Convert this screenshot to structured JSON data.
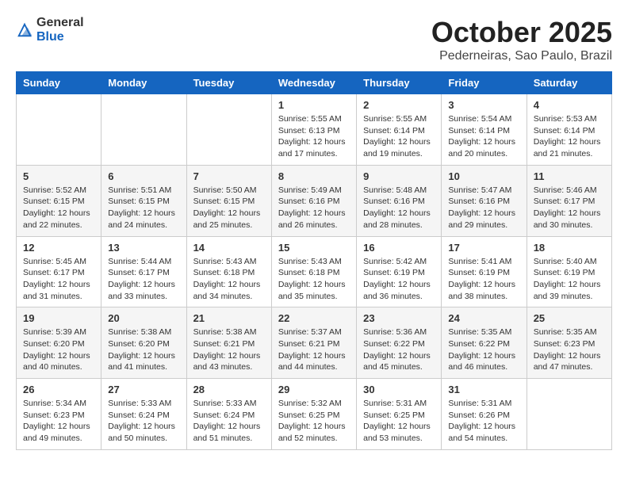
{
  "header": {
    "logo_general": "General",
    "logo_blue": "Blue",
    "month": "October 2025",
    "location": "Pederneiras, Sao Paulo, Brazil"
  },
  "days_of_week": [
    "Sunday",
    "Monday",
    "Tuesday",
    "Wednesday",
    "Thursday",
    "Friday",
    "Saturday"
  ],
  "weeks": [
    [
      {
        "day": "",
        "info": ""
      },
      {
        "day": "",
        "info": ""
      },
      {
        "day": "",
        "info": ""
      },
      {
        "day": "1",
        "info": "Sunrise: 5:55 AM\nSunset: 6:13 PM\nDaylight: 12 hours\nand 17 minutes."
      },
      {
        "day": "2",
        "info": "Sunrise: 5:55 AM\nSunset: 6:14 PM\nDaylight: 12 hours\nand 19 minutes."
      },
      {
        "day": "3",
        "info": "Sunrise: 5:54 AM\nSunset: 6:14 PM\nDaylight: 12 hours\nand 20 minutes."
      },
      {
        "day": "4",
        "info": "Sunrise: 5:53 AM\nSunset: 6:14 PM\nDaylight: 12 hours\nand 21 minutes."
      }
    ],
    [
      {
        "day": "5",
        "info": "Sunrise: 5:52 AM\nSunset: 6:15 PM\nDaylight: 12 hours\nand 22 minutes."
      },
      {
        "day": "6",
        "info": "Sunrise: 5:51 AM\nSunset: 6:15 PM\nDaylight: 12 hours\nand 24 minutes."
      },
      {
        "day": "7",
        "info": "Sunrise: 5:50 AM\nSunset: 6:15 PM\nDaylight: 12 hours\nand 25 minutes."
      },
      {
        "day": "8",
        "info": "Sunrise: 5:49 AM\nSunset: 6:16 PM\nDaylight: 12 hours\nand 26 minutes."
      },
      {
        "day": "9",
        "info": "Sunrise: 5:48 AM\nSunset: 6:16 PM\nDaylight: 12 hours\nand 28 minutes."
      },
      {
        "day": "10",
        "info": "Sunrise: 5:47 AM\nSunset: 6:16 PM\nDaylight: 12 hours\nand 29 minutes."
      },
      {
        "day": "11",
        "info": "Sunrise: 5:46 AM\nSunset: 6:17 PM\nDaylight: 12 hours\nand 30 minutes."
      }
    ],
    [
      {
        "day": "12",
        "info": "Sunrise: 5:45 AM\nSunset: 6:17 PM\nDaylight: 12 hours\nand 31 minutes."
      },
      {
        "day": "13",
        "info": "Sunrise: 5:44 AM\nSunset: 6:17 PM\nDaylight: 12 hours\nand 33 minutes."
      },
      {
        "day": "14",
        "info": "Sunrise: 5:43 AM\nSunset: 6:18 PM\nDaylight: 12 hours\nand 34 minutes."
      },
      {
        "day": "15",
        "info": "Sunrise: 5:43 AM\nSunset: 6:18 PM\nDaylight: 12 hours\nand 35 minutes."
      },
      {
        "day": "16",
        "info": "Sunrise: 5:42 AM\nSunset: 6:19 PM\nDaylight: 12 hours\nand 36 minutes."
      },
      {
        "day": "17",
        "info": "Sunrise: 5:41 AM\nSunset: 6:19 PM\nDaylight: 12 hours\nand 38 minutes."
      },
      {
        "day": "18",
        "info": "Sunrise: 5:40 AM\nSunset: 6:19 PM\nDaylight: 12 hours\nand 39 minutes."
      }
    ],
    [
      {
        "day": "19",
        "info": "Sunrise: 5:39 AM\nSunset: 6:20 PM\nDaylight: 12 hours\nand 40 minutes."
      },
      {
        "day": "20",
        "info": "Sunrise: 5:38 AM\nSunset: 6:20 PM\nDaylight: 12 hours\nand 41 minutes."
      },
      {
        "day": "21",
        "info": "Sunrise: 5:38 AM\nSunset: 6:21 PM\nDaylight: 12 hours\nand 43 minutes."
      },
      {
        "day": "22",
        "info": "Sunrise: 5:37 AM\nSunset: 6:21 PM\nDaylight: 12 hours\nand 44 minutes."
      },
      {
        "day": "23",
        "info": "Sunrise: 5:36 AM\nSunset: 6:22 PM\nDaylight: 12 hours\nand 45 minutes."
      },
      {
        "day": "24",
        "info": "Sunrise: 5:35 AM\nSunset: 6:22 PM\nDaylight: 12 hours\nand 46 minutes."
      },
      {
        "day": "25",
        "info": "Sunrise: 5:35 AM\nSunset: 6:23 PM\nDaylight: 12 hours\nand 47 minutes."
      }
    ],
    [
      {
        "day": "26",
        "info": "Sunrise: 5:34 AM\nSunset: 6:23 PM\nDaylight: 12 hours\nand 49 minutes."
      },
      {
        "day": "27",
        "info": "Sunrise: 5:33 AM\nSunset: 6:24 PM\nDaylight: 12 hours\nand 50 minutes."
      },
      {
        "day": "28",
        "info": "Sunrise: 5:33 AM\nSunset: 6:24 PM\nDaylight: 12 hours\nand 51 minutes."
      },
      {
        "day": "29",
        "info": "Sunrise: 5:32 AM\nSunset: 6:25 PM\nDaylight: 12 hours\nand 52 minutes."
      },
      {
        "day": "30",
        "info": "Sunrise: 5:31 AM\nSunset: 6:25 PM\nDaylight: 12 hours\nand 53 minutes."
      },
      {
        "day": "31",
        "info": "Sunrise: 5:31 AM\nSunset: 6:26 PM\nDaylight: 12 hours\nand 54 minutes."
      },
      {
        "day": "",
        "info": ""
      }
    ]
  ]
}
